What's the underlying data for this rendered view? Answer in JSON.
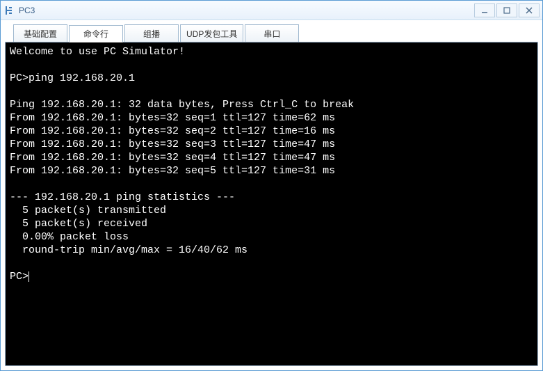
{
  "window": {
    "title": "PC3"
  },
  "tabs": [
    {
      "label": "基础配置",
      "active": false
    },
    {
      "label": "命令行",
      "active": true
    },
    {
      "label": "组播",
      "active": false
    },
    {
      "label": "UDP发包工具",
      "active": false
    },
    {
      "label": "串口",
      "active": false
    }
  ],
  "terminal": {
    "lines": [
      "Welcome to use PC Simulator!",
      "",
      "PC>ping 192.168.20.1",
      "",
      "Ping 192.168.20.1: 32 data bytes, Press Ctrl_C to break",
      "From 192.168.20.1: bytes=32 seq=1 ttl=127 time=62 ms",
      "From 192.168.20.1: bytes=32 seq=2 ttl=127 time=16 ms",
      "From 192.168.20.1: bytes=32 seq=3 ttl=127 time=47 ms",
      "From 192.168.20.1: bytes=32 seq=4 ttl=127 time=47 ms",
      "From 192.168.20.1: bytes=32 seq=5 ttl=127 time=31 ms",
      "",
      "--- 192.168.20.1 ping statistics ---",
      "  5 packet(s) transmitted",
      "  5 packet(s) received",
      "  0.00% packet loss",
      "  round-trip min/avg/max = 16/40/62 ms",
      ""
    ],
    "prompt": "PC>"
  }
}
